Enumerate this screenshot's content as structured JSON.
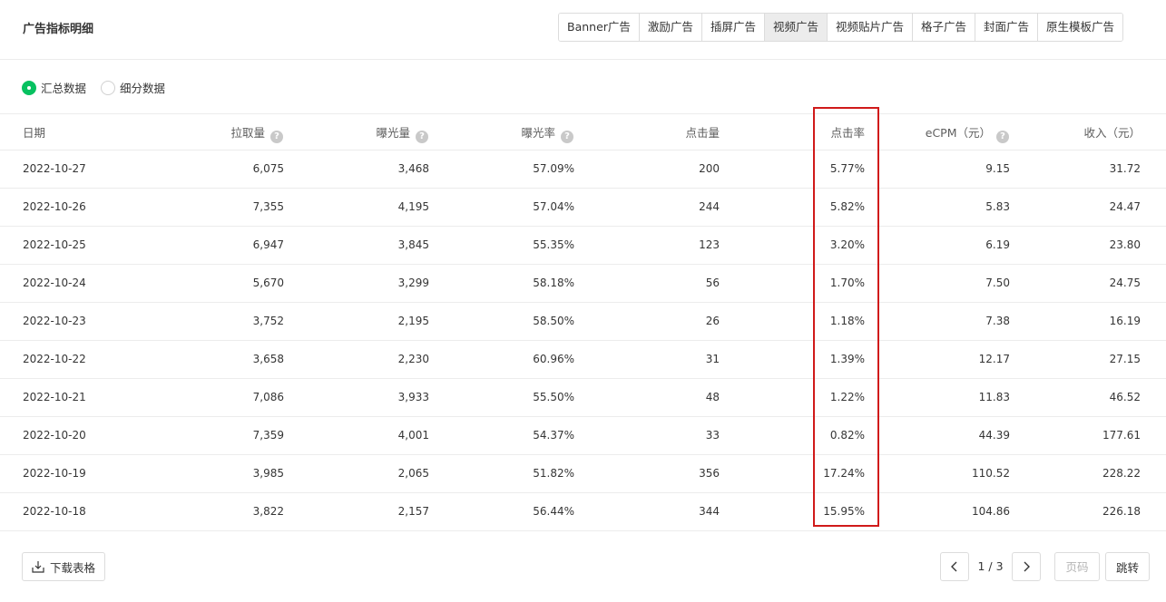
{
  "header": {
    "title": "广告指标明细",
    "tabs": [
      "Banner广告",
      "激励广告",
      "插屏广告",
      "视频广告",
      "视频贴片广告",
      "格子广告",
      "封面广告",
      "原生模板广告"
    ],
    "active_tab": "视频广告"
  },
  "view_options": {
    "summary_label": "汇总数据",
    "detail_label": "细分数据",
    "selected": "汇总数据"
  },
  "table": {
    "columns": [
      "日期",
      "拉取量",
      "曝光量",
      "曝光率",
      "点击量",
      "点击率",
      "eCPM（元）",
      "收入（元）"
    ],
    "rows": [
      [
        "2022-10-27",
        "6,075",
        "3,468",
        "57.09%",
        "200",
        "5.77%",
        "9.15",
        "31.72"
      ],
      [
        "2022-10-26",
        "7,355",
        "4,195",
        "57.04%",
        "244",
        "5.82%",
        "5.83",
        "24.47"
      ],
      [
        "2022-10-25",
        "6,947",
        "3,845",
        "55.35%",
        "123",
        "3.20%",
        "6.19",
        "23.80"
      ],
      [
        "2022-10-24",
        "5,670",
        "3,299",
        "58.18%",
        "56",
        "1.70%",
        "7.50",
        "24.75"
      ],
      [
        "2022-10-23",
        "3,752",
        "2,195",
        "58.50%",
        "26",
        "1.18%",
        "7.38",
        "16.19"
      ],
      [
        "2022-10-22",
        "3,658",
        "2,230",
        "60.96%",
        "31",
        "1.39%",
        "12.17",
        "27.15"
      ],
      [
        "2022-10-21",
        "7,086",
        "3,933",
        "55.50%",
        "48",
        "1.22%",
        "11.83",
        "46.52"
      ],
      [
        "2022-10-20",
        "7,359",
        "4,001",
        "54.37%",
        "33",
        "0.82%",
        "44.39",
        "177.61"
      ],
      [
        "2022-10-19",
        "3,985",
        "2,065",
        "51.82%",
        "356",
        "17.24%",
        "110.52",
        "228.22"
      ],
      [
        "2022-10-18",
        "3,822",
        "2,157",
        "56.44%",
        "344",
        "15.95%",
        "104.86",
        "226.18"
      ]
    ]
  },
  "footer": {
    "download_label": "下载表格",
    "page_indicator": "1 / 3",
    "page_input_placeholder": "页码",
    "jump_label": "跳转"
  },
  "colors": {
    "accent": "#07c160",
    "highlight_border": "#d01a1a",
    "active_tab_bg": "#ececec"
  }
}
